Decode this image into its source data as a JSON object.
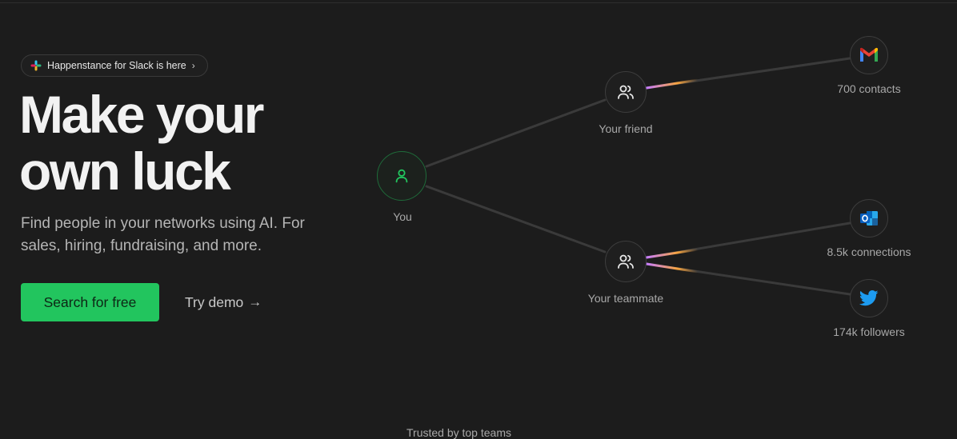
{
  "announcement": {
    "text": "Happenstance for Slack is here",
    "icon": "slack-icon",
    "chevron": "›"
  },
  "hero": {
    "headline_line1": "Make your",
    "headline_line2": "own luck",
    "subtitle": "Find people in your networks using AI. For sales, hiring, fundraising, and more."
  },
  "cta": {
    "primary_label": "Search for free",
    "secondary_label": "Try demo",
    "secondary_arrow": "→"
  },
  "network": {
    "you": {
      "label": "You",
      "icon": "user-icon"
    },
    "friend": {
      "label": "Your friend",
      "icon": "users-icon"
    },
    "teammate": {
      "label": "Your teammate",
      "icon": "users-icon"
    },
    "gmail": {
      "label": "700 contacts",
      "icon": "gmail-icon"
    },
    "outlook": {
      "label": "8.5k connections",
      "icon": "outlook-icon"
    },
    "twitter": {
      "label": "174k followers",
      "icon": "twitter-icon"
    }
  },
  "footer": {
    "trusted": "Trusted by top teams"
  },
  "colors": {
    "accent": "#22c55e",
    "background": "#1c1c1c",
    "gradient_start": "#c77dff",
    "gradient_end": "#f7a440"
  }
}
